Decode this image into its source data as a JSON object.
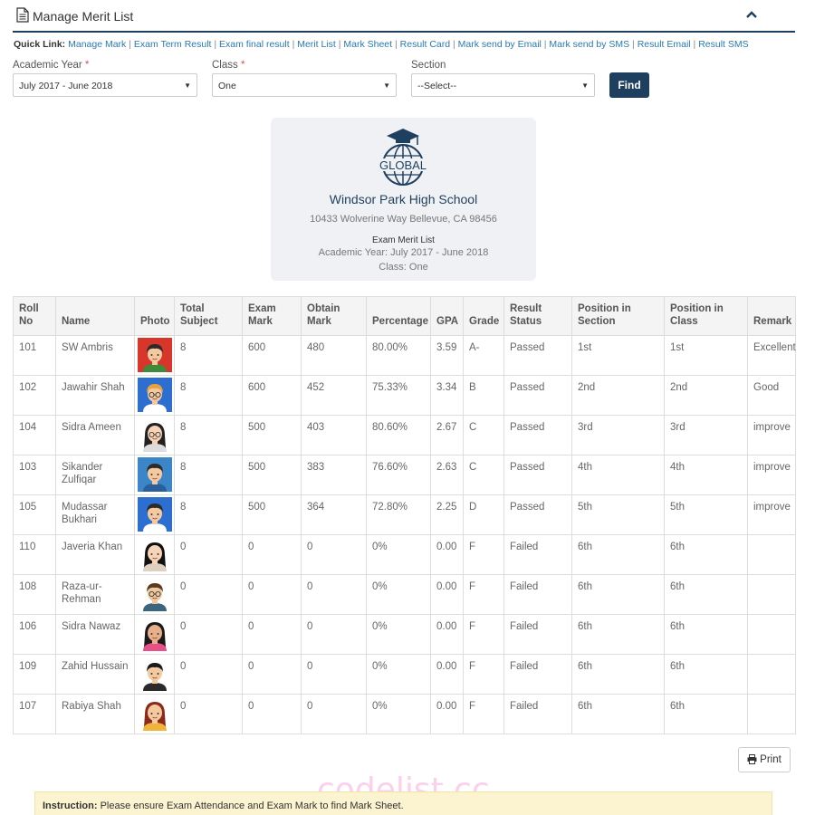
{
  "header": {
    "title": "Manage Merit List",
    "icon": "document-icon",
    "collapse_icon": "chevron-up-icon"
  },
  "quick_links": {
    "label": "Quick Link:",
    "items": [
      "Manage Mark",
      "Exam Term Result",
      "Exam final result",
      "Merit List",
      "Mark Sheet",
      "Result Card",
      "Mark send by Email",
      "Mark send by SMS",
      "Result Email",
      "Result SMS"
    ]
  },
  "filters": {
    "academic_year": {
      "label": "Academic Year",
      "required": "*",
      "value": "July 2017 - June 2018"
    },
    "class": {
      "label": "Class",
      "required": "*",
      "value": "One"
    },
    "section": {
      "label": "Section",
      "value": "--Select--"
    },
    "find_label": "Find"
  },
  "school_card": {
    "logo_text": "GLOBAL",
    "school_name": "Windsor Park High School",
    "address": "10433 Wolverine Way Bellevue, CA 98456",
    "list_title": "Exam Merit List",
    "academic_year": "Academic Year: July 2017 - June 2018",
    "class": "Class: One"
  },
  "table": {
    "headers": [
      "Roll No",
      "Name",
      "Photo",
      "Total Subject",
      "Exam Mark",
      "Obtain Mark",
      "Percentage",
      "GPA",
      "Grade",
      "Result Status",
      "Position in Section",
      "Position in Class",
      "Remark"
    ],
    "rows": [
      {
        "roll": "101",
        "name": "SW Ambris",
        "avatar": "boy-red",
        "total": "8",
        "exam": "600",
        "obtain": "480",
        "pct": "80.00%",
        "gpa": "3.59",
        "grade": "A-",
        "status": "Passed",
        "pos_section": "1st",
        "pos_class": "1st",
        "remark": "Excellent"
      },
      {
        "roll": "102",
        "name": "Jawahir Shah",
        "avatar": "boy-glasses",
        "total": "8",
        "exam": "600",
        "obtain": "452",
        "pct": "75.33%",
        "gpa": "3.34",
        "grade": "B",
        "status": "Passed",
        "pos_section": "2nd",
        "pos_class": "2nd",
        "remark": "Good"
      },
      {
        "roll": "104",
        "name": "Sidra Ameen",
        "avatar": "girl-glasses",
        "total": "8",
        "exam": "500",
        "obtain": "403",
        "pct": "80.60%",
        "gpa": "2.67",
        "grade": "C",
        "status": "Passed",
        "pos_section": "3rd",
        "pos_class": "3rd",
        "remark": "improve"
      },
      {
        "roll": "103",
        "name": "Sikander Zulfiqar",
        "avatar": "boy-blue",
        "total": "8",
        "exam": "500",
        "obtain": "383",
        "pct": "76.60%",
        "gpa": "2.63",
        "grade": "C",
        "status": "Passed",
        "pos_section": "4th",
        "pos_class": "4th",
        "remark": "improve"
      },
      {
        "roll": "105",
        "name": "Mudassar Bukhari",
        "avatar": "boy-tie",
        "total": "8",
        "exam": "500",
        "obtain": "364",
        "pct": "72.80%",
        "gpa": "2.25",
        "grade": "D",
        "status": "Passed",
        "pos_section": "5th",
        "pos_class": "5th",
        "remark": "improve"
      },
      {
        "roll": "110",
        "name": "Javeria Khan",
        "avatar": "girl-dark",
        "total": "0",
        "exam": "0",
        "obtain": "0",
        "pct": "0%",
        "gpa": "0.00",
        "grade": "F",
        "status": "Failed",
        "pos_section": "6th",
        "pos_class": "6th",
        "remark": ""
      },
      {
        "roll": "108",
        "name": "Raza-ur-Rehman",
        "avatar": "man-glasses",
        "total": "0",
        "exam": "0",
        "obtain": "0",
        "pct": "0%",
        "gpa": "0.00",
        "grade": "F",
        "status": "Failed",
        "pos_section": "6th",
        "pos_class": "6th",
        "remark": ""
      },
      {
        "roll": "106",
        "name": "Sidra Nawaz",
        "avatar": "girl-pink",
        "total": "0",
        "exam": "0",
        "obtain": "0",
        "pct": "0%",
        "gpa": "0.00",
        "grade": "F",
        "status": "Failed",
        "pos_section": "6th",
        "pos_class": "6th",
        "remark": ""
      },
      {
        "roll": "109",
        "name": "Zahid Hussain",
        "avatar": "man-suit",
        "total": "0",
        "exam": "0",
        "obtain": "0",
        "pct": "0%",
        "gpa": "0.00",
        "grade": "F",
        "status": "Failed",
        "pos_section": "6th",
        "pos_class": "6th",
        "remark": ""
      },
      {
        "roll": "107",
        "name": "Rabiya Shah",
        "avatar": "girl-yellow",
        "total": "0",
        "exam": "0",
        "obtain": "0",
        "pct": "0%",
        "gpa": "0.00",
        "grade": "F",
        "status": "Failed",
        "pos_section": "6th",
        "pos_class": "6th",
        "remark": ""
      }
    ]
  },
  "print_label": "Print",
  "instruction": {
    "label": "Instruction:",
    "text": "Please ensure Exam Attendance and Exam Mark to find Mark Sheet."
  },
  "watermark": "codelist.cc",
  "colors": {
    "primary": "#1f3f5e",
    "link": "#2a7ab0",
    "card_bg": "#eff1f4",
    "instruction_bg": "#fcf3d0",
    "required": "#d9534f"
  }
}
